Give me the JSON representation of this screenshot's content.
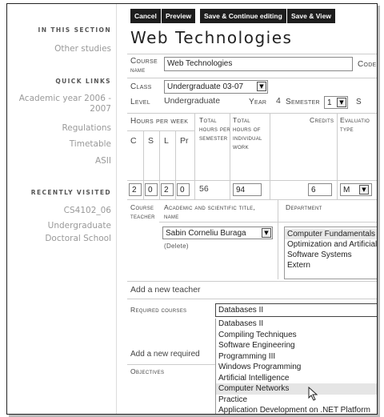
{
  "left": {
    "in_this_section": "IN THIS SECTION",
    "other_studies": "Other studies",
    "quick_links": "QUICK LINKS",
    "quick_links_items": [
      "Academic year 2006 -",
      "2007",
      "Regulations",
      "Timetable",
      "ASII"
    ],
    "recently_visited": "RECENTLY VISITED",
    "recent_items": [
      "CS4102_06",
      "Undergraduate",
      "Doctoral School"
    ]
  },
  "toolbar": {
    "cancel": "Cancel",
    "preview": "Preview",
    "save_continue": "Save & Continue editing",
    "save_view": "Save & View"
  },
  "title": "Web Technologies",
  "form": {
    "course_name_label_1": "Course",
    "course_name_label_2": "name",
    "course_name_value": "Web Technologies",
    "code_label": "Code",
    "class_label": "Class",
    "class_value": "Undergraduate 03-07",
    "level_label": "Level",
    "level_value": "Undergraduate",
    "year_label": "Year",
    "year_value": "4",
    "semester_label": "Semester",
    "semester_value": "1",
    "hours_per_week": "Hours per week",
    "total_hours_1": "Total",
    "total_hours_2": "hours per",
    "total_hours_3": "semester",
    "total_ind_1": "Total",
    "total_ind_2": "hours of",
    "total_ind_3": "individual",
    "total_ind_4": "work",
    "credits": "Credits",
    "evaluation_1": "Evaluatio",
    "evaluation_2": "type",
    "hcols": [
      "C",
      "S",
      "L",
      "Pr"
    ],
    "hvals": [
      "2",
      "0",
      "2",
      "0"
    ],
    "total_hours_value": "56",
    "total_ind_value": "94",
    "credits_value": "6",
    "evaluation_value": "M",
    "teacher_label_1": "Course",
    "teacher_label_2": "teacher",
    "academic_title_1": "Academic and scientific title,",
    "academic_title_2": "name",
    "department_label": "Department",
    "teacher_value": "Sabin Corneliu Buraga",
    "delete": "(Delete)",
    "departments": [
      "Computer Fundamentals a",
      "Optimization and Artificial",
      "Software Systems",
      "Extern"
    ],
    "add_teacher": "Add a new teacher",
    "required_courses_label": "Required courses",
    "required_selected": "Databases II",
    "add_required": "Add a new required",
    "objectives_label": "Objectives",
    "required_options": [
      "Databases II",
      "Compiling Techniques",
      "Software Engineering",
      "Programming III",
      "Windows Programming",
      "Artificial Intelligence",
      "Computer Networks",
      "Practice",
      "Application Development on .NET Platform"
    ]
  }
}
